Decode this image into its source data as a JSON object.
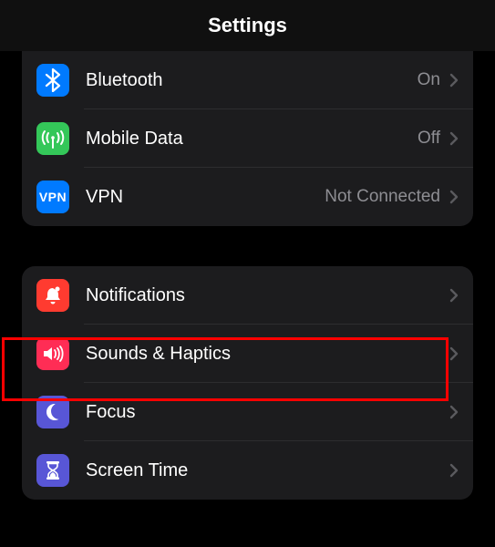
{
  "header": {
    "title": "Settings"
  },
  "groups": [
    {
      "rows": [
        {
          "id": "bluetooth",
          "label": "Bluetooth",
          "value": "On",
          "iconColor": "#007aff"
        },
        {
          "id": "mobile-data",
          "label": "Mobile Data",
          "value": "Off",
          "iconColor": "#34c759"
        },
        {
          "id": "vpn",
          "label": "VPN",
          "value": "Not Connected",
          "iconColor": "#007aff"
        }
      ]
    },
    {
      "rows": [
        {
          "id": "notifications",
          "label": "Notifications",
          "value": "",
          "iconColor": "#ff3b30"
        },
        {
          "id": "sounds-haptics",
          "label": "Sounds & Haptics",
          "value": "",
          "iconColor": "#ff2d55",
          "highlight": true
        },
        {
          "id": "focus",
          "label": "Focus",
          "value": "",
          "iconColor": "#5856d6"
        },
        {
          "id": "screen-time",
          "label": "Screen Time",
          "value": "",
          "iconColor": "#5856d6"
        }
      ]
    }
  ],
  "colors": {
    "highlight": "#ff0000"
  }
}
